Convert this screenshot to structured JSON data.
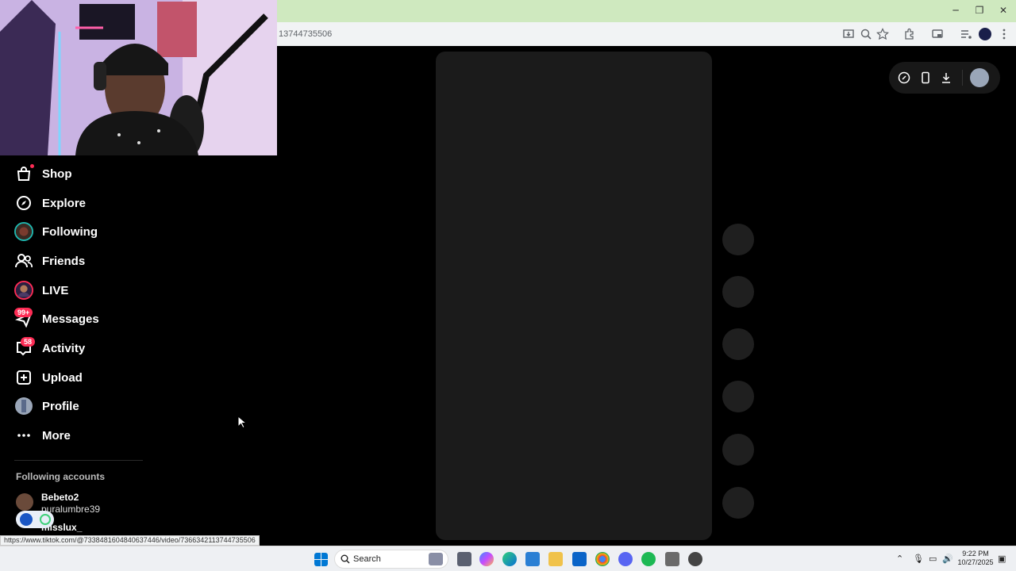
{
  "browser": {
    "url_fragment": "13744735506",
    "minimize": "─",
    "restore": "❐",
    "close": "✕"
  },
  "sidebar": {
    "items": [
      {
        "label": "Shop"
      },
      {
        "label": "Explore"
      },
      {
        "label": "Following"
      },
      {
        "label": "Friends"
      },
      {
        "label": "LIVE"
      },
      {
        "label": "Messages",
        "badge": "99+"
      },
      {
        "label": "Activity",
        "badge": "58"
      },
      {
        "label": "Upload"
      },
      {
        "label": "Profile"
      },
      {
        "label": "More"
      }
    ],
    "following_title": "Following accounts",
    "accounts": [
      {
        "name": "Bebeto2",
        "handle": "puralumbre39"
      },
      {
        "name": "misslux_",
        "handle": ""
      }
    ]
  },
  "status_url": "https://www.tiktok.com/@7338481604840637446/video/7366342113744735506",
  "taskbar": {
    "search_label": "Search",
    "time": "9:22 PM",
    "date": "10/27/2025"
  },
  "colors": {
    "accent": "#fe2c55",
    "titlebar": "#cfe9bf",
    "panel": "#1b1b1b"
  }
}
